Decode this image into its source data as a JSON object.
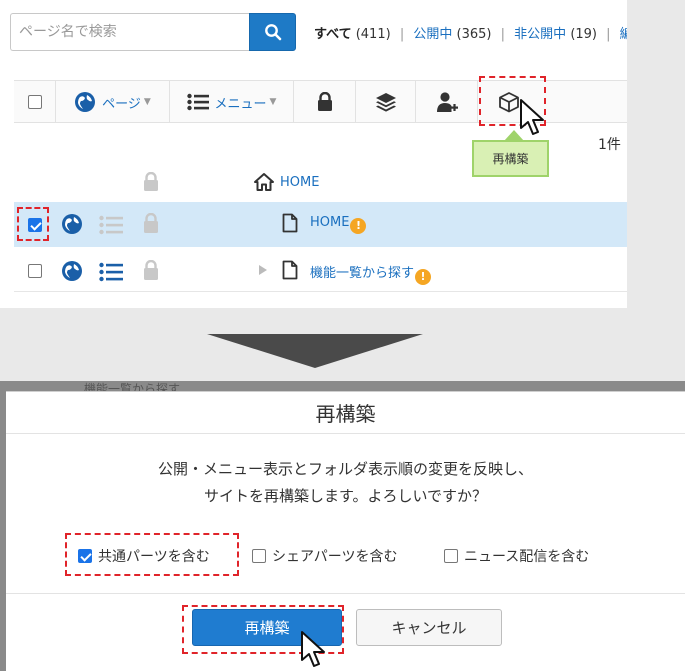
{
  "search": {
    "placeholder": "ページ名で検索"
  },
  "filters": {
    "all": "すべて",
    "all_count": "(411)",
    "public": "公開中",
    "public_count": "(365)",
    "private": "非公開中",
    "private_count": "(19)",
    "edit_partial": "編"
  },
  "toolbar": {
    "page_label": "ページ",
    "menu_label": "メニュー"
  },
  "tooltip": "再構築",
  "count_label": "1件",
  "rows": [
    {
      "label": "HOME"
    },
    {
      "label": "HOME",
      "warn": "!"
    },
    {
      "label": "機能一覧から探す",
      "warn": "!"
    }
  ],
  "background_ghost": "機能一覧から探す",
  "dialog": {
    "title": "再構築",
    "message_line1": "公開・メニュー表示とフォルダ表示順の変更を反映し、",
    "message_line2": "サイトを再構築します。よろしいですか？",
    "options": [
      {
        "label": "共通パーツを含む",
        "checked": true
      },
      {
        "label": "シェアパーツを含む",
        "checked": false
      },
      {
        "label": "ニュース配信を含む",
        "checked": false
      }
    ],
    "confirm_label": "再構築",
    "cancel_label": "キャンセル"
  },
  "colors": {
    "accent": "#1f7cd0",
    "highlight_row": "#d3e8f8",
    "tooltip_bg": "#d9f0b4",
    "annotation": "#e0242a",
    "warn": "#f5a623"
  }
}
